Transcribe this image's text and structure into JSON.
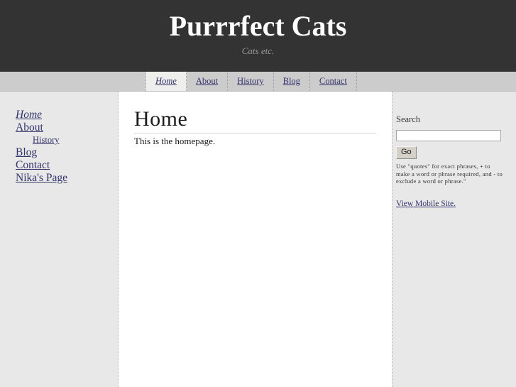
{
  "header": {
    "title": "Purrrfect Cats",
    "tagline": "Cats etc."
  },
  "topnav": {
    "items": [
      {
        "label": "Home",
        "active": true
      },
      {
        "label": "About",
        "active": false
      },
      {
        "label": "History",
        "active": false
      },
      {
        "label": "Blog",
        "active": false
      },
      {
        "label": "Contact",
        "active": false
      }
    ]
  },
  "sidebar": {
    "items": [
      {
        "label": "Home",
        "current": true,
        "sub": false
      },
      {
        "label": "About",
        "current": false,
        "sub": false
      },
      {
        "label": "History",
        "current": false,
        "sub": true
      },
      {
        "label": "Blog",
        "current": false,
        "sub": false
      },
      {
        "label": "Contact",
        "current": false,
        "sub": false
      },
      {
        "label": "Nika's Page",
        "current": false,
        "sub": false
      }
    ]
  },
  "main": {
    "title": "Home",
    "body": "This is the homepage."
  },
  "search": {
    "heading": "Search",
    "value": "",
    "placeholder": "",
    "button_label": "Go",
    "help_text": "Use \"quotes\" for exact phrases, + to make a word or phrase required, and - to exclude a word or phrase.\"",
    "mobile_link": "View Mobile Site."
  },
  "colors": {
    "banner_bg": "#333333",
    "navbar_bg": "#cccccc",
    "sidebar_bg": "#e8e8e8",
    "content_bg": "#ffffff",
    "link": "#33336b",
    "tagline": "#9a9a9a"
  }
}
